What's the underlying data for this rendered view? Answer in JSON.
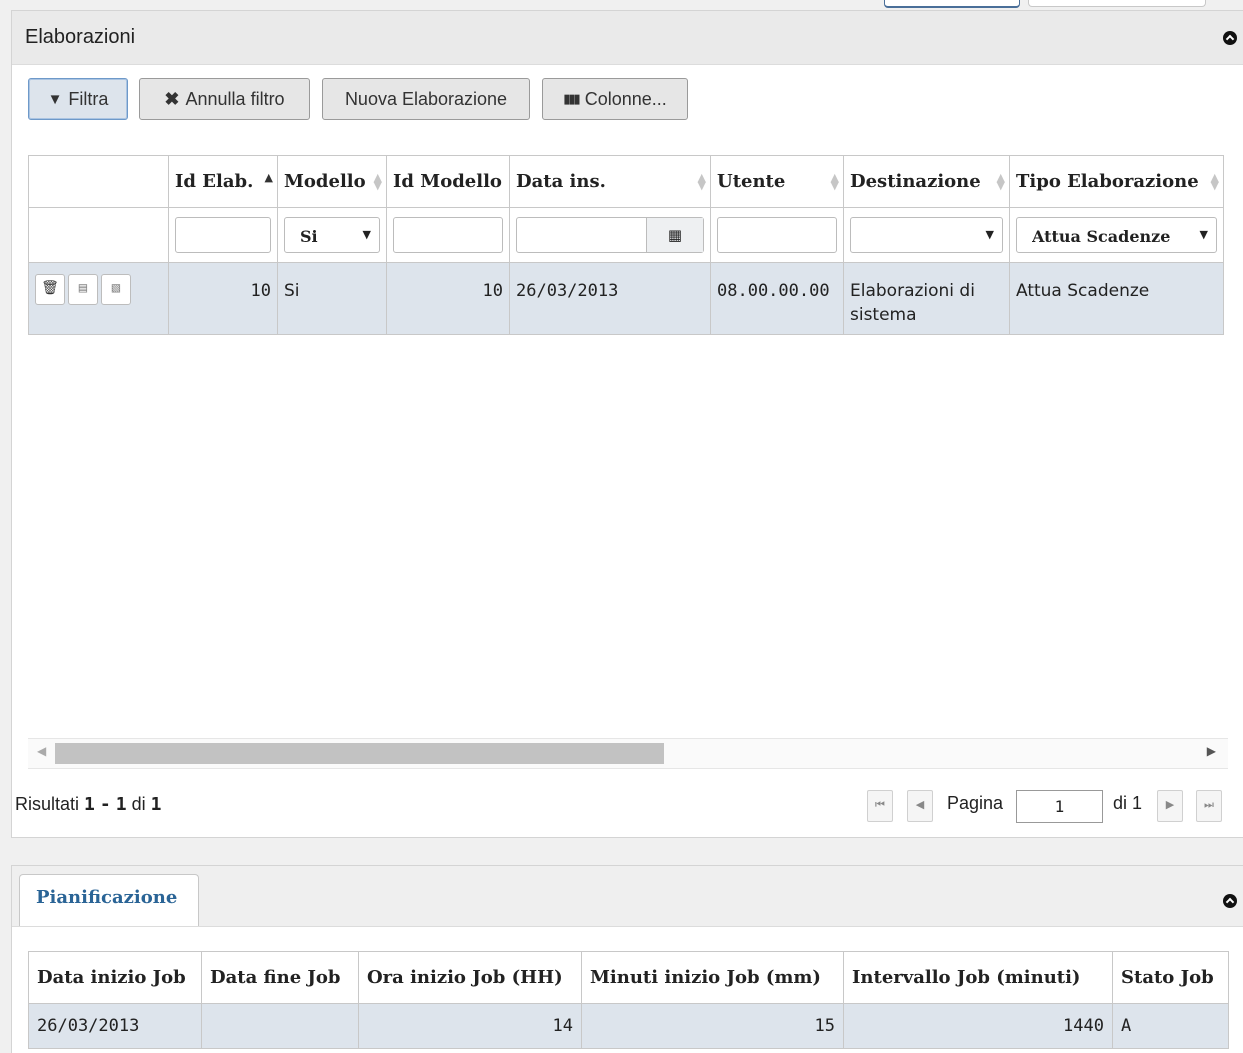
{
  "panel_main": {
    "title": "Elaborazioni",
    "toolbar": {
      "filter_label": "Filtra",
      "clear_filter_label": "Annulla filtro",
      "new_label": "Nuova Elaborazione",
      "columns_label": "Colonne..."
    },
    "grid": {
      "columns": [
        "Id Elab.",
        "Modello",
        "Id Modello",
        "Data ins.",
        "Utente",
        "Destinazione",
        "Tipo Elaborazione"
      ],
      "filters": {
        "modello_selected": "Si",
        "destinazione_selected": "",
        "tipo_selected": "Attua Scadenze"
      },
      "rows": [
        {
          "id_elab": "10",
          "modello": "Si",
          "id_modello": "10",
          "data_ins": "26/03/2013",
          "utente": "08.00.00.00",
          "destinazione": "Elaborazioni di sistema",
          "tipo": "Attua Scadenze"
        }
      ]
    },
    "results": {
      "prefix": "Risultati",
      "from": "1",
      "sep": "-",
      "to": "1",
      "of_label": "di",
      "total": "1"
    },
    "pager": {
      "page_label": "Pagina",
      "page_value": "1",
      "of_pages": "di 1"
    }
  },
  "panel_plan": {
    "tab_label": "Pianificazione",
    "columns": [
      "Data inizio Job",
      "Data fine Job",
      "Ora inizio Job (HH)",
      "Minuti inizio Job (mm)",
      "Intervallo Job (minuti)",
      "Stato Job"
    ],
    "rows": [
      {
        "data_inizio": "26/03/2013",
        "data_fine": "",
        "ora_inizio": "14",
        "minuti_inizio": "15",
        "intervallo": "1440",
        "stato": "A"
      }
    ]
  },
  "icons": {
    "filter": "filter-icon",
    "clear": "close-icon",
    "columns": "columns-icon",
    "calendar": "calendar-icon",
    "trash": "trash-icon",
    "document": "document-icon",
    "pdf": "pdf-icon",
    "collapse": "collapse-icon"
  },
  "colors": {
    "selected_row": "#dde4ec",
    "header_bg": "#eaeaea",
    "tab_text": "#2a6496"
  }
}
